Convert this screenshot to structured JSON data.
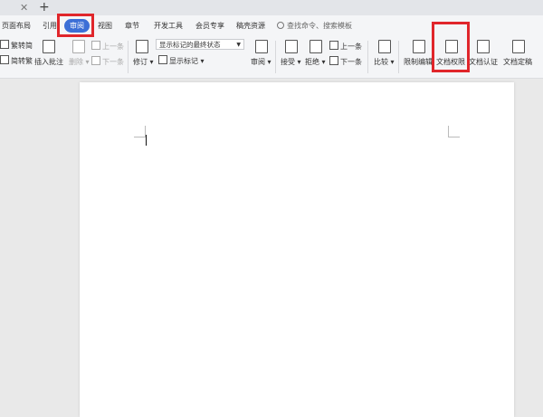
{
  "tabbar": {
    "close_glyph": "✕",
    "new_glyph": "+"
  },
  "menubar": {
    "items": [
      {
        "label": "页面布局"
      },
      {
        "label": "引用"
      },
      {
        "label": "审阅",
        "active": true
      },
      {
        "label": "视图"
      },
      {
        "label": "章节"
      },
      {
        "label": "开发工具"
      },
      {
        "label": "会员专享"
      },
      {
        "label": "稿壳资源"
      }
    ],
    "search_placeholder": "查找命令、搜索模板"
  },
  "ribbon": {
    "trad_simplified": "繁转简",
    "simplified_trad": "简转繁",
    "insert_comment": "插入批注",
    "delete": "删除",
    "prev_comment": "上一条",
    "next_comment": "下一条",
    "revise": "修订",
    "display_state": "显示标记的最终状态",
    "show_markup": "显示标记",
    "review": "审阅",
    "accept": "接受",
    "reject": "拒绝",
    "prev_change": "上一条",
    "next_change": "下一条",
    "compare": "比较",
    "restrict_edit": "限制编辑",
    "doc_permission": "文档权限",
    "doc_cert": "文档认证",
    "doc_finalize": "文档定稿"
  },
  "colors": {
    "accent": "#3c6fd6",
    "highlight": "#e0262b"
  }
}
